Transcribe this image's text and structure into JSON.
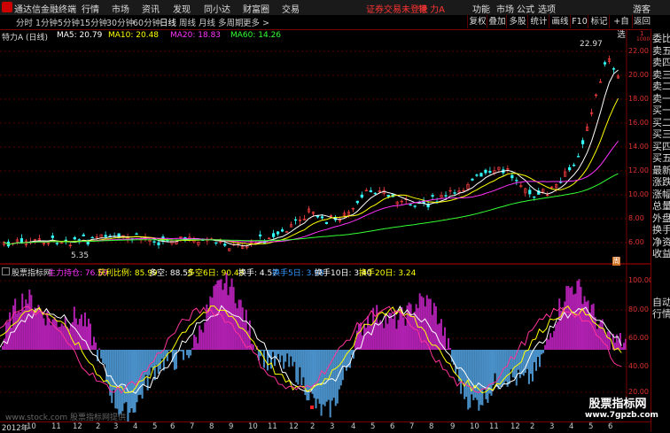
{
  "menubar": {
    "app_title": "通达信金融终端",
    "menus": [
      "行情",
      "市场",
      "资讯",
      "发现",
      "同小达",
      "财富圈",
      "交易"
    ],
    "warning": "证券交易未登录",
    "stock_short": "特 力A",
    "right": [
      "功能",
      "市场",
      "公式",
      "选项",
      "游客"
    ]
  },
  "toolbar": {
    "periods": [
      "分时",
      "1分钟",
      "5分钟",
      "15分钟",
      "30分钟",
      "60分钟",
      "日线",
      "周线",
      "月线",
      "多周期",
      "更多 >"
    ],
    "active": "日线",
    "right_buttons": [
      "复权",
      "叠加",
      "多股",
      "统计",
      "画线",
      "F10",
      "标记",
      "+自选",
      "返回"
    ]
  },
  "main_chart": {
    "stock_label": "特力A (日线)",
    "ma_items": [
      {
        "label": "MA5: 20.79",
        "color": "#ffffff"
      },
      {
        "label": "MA10: 20.48",
        "color": "#ffff00"
      },
      {
        "label": "MA20: 18.83",
        "color": "#ff33ff"
      },
      {
        "label": "MA60: 14.26",
        "color": "#33ff33"
      }
    ],
    "y_ticks": [
      "22.00",
      "20.00",
      "18.00",
      "16.00",
      "14.00",
      "12.00",
      "10.00",
      "8.00",
      "6.00"
    ],
    "high_label": "22.97",
    "low_label": "5.35",
    "corner_labels": [
      "1",
      "1000"
    ],
    "bottom_marker": "周"
  },
  "indicator": {
    "name": "股票指标网",
    "items": [
      {
        "label": "主力持仓: 76.59",
        "color": "#ff33ff"
      },
      {
        "label": "获利比例: 85.99",
        "color": "#ffff00"
      },
      {
        "label": "多空: 88.55",
        "color": "#ffffff"
      },
      {
        "label": "多空6日: 90.48",
        "color": "#ffff00"
      },
      {
        "label": "换手: 4.57",
        "color": "#ffffff"
      },
      {
        "label": "换手5日: 3.98",
        "color": "#3399ff"
      },
      {
        "label": "换手10日: 3.40",
        "color": "#ffffff"
      },
      {
        "label": "换手20日: 3.24",
        "color": "#ffff00"
      }
    ],
    "y_ticks": [
      "100.00",
      "80.00",
      "60.00",
      "40.00",
      "20.00"
    ]
  },
  "sidebar": {
    "items": [
      "委比",
      "卖五",
      "卖四",
      "卖三",
      "卖二",
      "卖一",
      "买一",
      "买二",
      "买三",
      "买四",
      "买五",
      "最新",
      "涨跌",
      "涨幅",
      "总量",
      "外盘",
      "换手",
      "净资",
      "收益"
    ],
    "bottom": [
      "自动",
      "行情"
    ]
  },
  "time_axis": {
    "labels": [
      "2012年",
      "10",
      "11",
      "12",
      "2",
      "3",
      "4",
      "5",
      "6",
      "7",
      "8",
      "9",
      "10",
      "11",
      "12",
      "2",
      "3",
      "4",
      "5",
      "6",
      "7",
      "8",
      "9",
      "10",
      "11",
      "12",
      "2",
      "3",
      "4",
      "5",
      "6",
      "7"
    ]
  },
  "watermark": {
    "left_text": "www.stock.com 股票指标网提供",
    "right_title": "股票指标网",
    "right_url": "www.7gpzb.com"
  }
}
